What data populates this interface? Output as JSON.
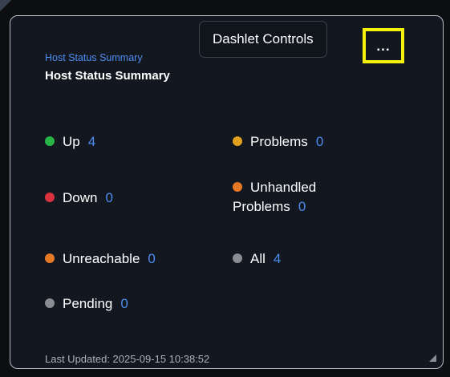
{
  "dashlet": {
    "link_title": "Host Status Summary",
    "title": "Host Status Summary",
    "tooltip": "Dashlet Controls",
    "more_label": "...",
    "statuses": [
      {
        "label": "Up",
        "count": "4",
        "color": "#27b545"
      },
      {
        "label": "Problems",
        "count": "0",
        "color": "#e0a21c"
      },
      {
        "label": "Down",
        "count": "0",
        "color": "#d9323e"
      },
      {
        "label": "Unhandled",
        "label2": "Problems",
        "count": "0",
        "color": "#e57a24"
      },
      {
        "label": "Unreachable",
        "count": "0",
        "color": "#e57a24"
      },
      {
        "label": "All",
        "count": "4",
        "color": "#8a8d92"
      },
      {
        "label": "Pending",
        "count": "0",
        "color": "#8a8d92"
      }
    ],
    "footer": "Last Updated: 2025-09-15 10:38:52"
  }
}
